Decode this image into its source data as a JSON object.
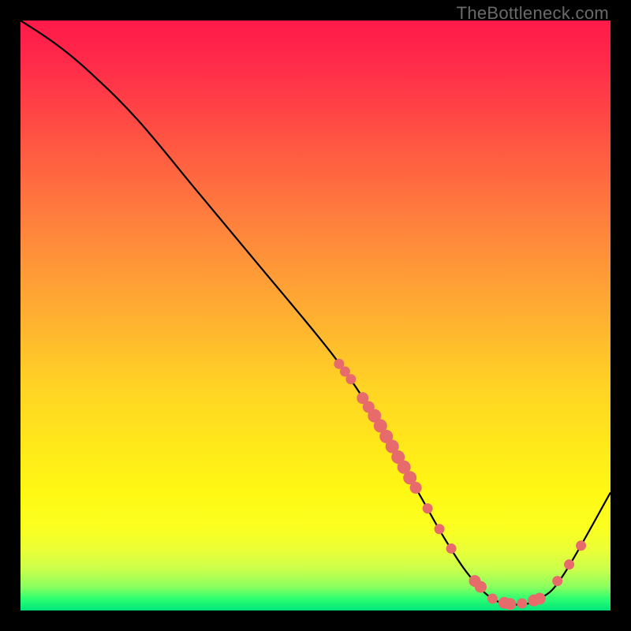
{
  "attribution": "TheBottleneck.com",
  "chart_data": {
    "type": "line",
    "title": "",
    "xlabel": "",
    "ylabel": "",
    "xlim": [
      0,
      100
    ],
    "ylim": [
      0,
      100
    ],
    "grid": false,
    "series": [
      {
        "name": "curve",
        "x": [
          0,
          6,
          12,
          20,
          30,
          40,
          50,
          55,
          60,
          64,
          68,
          72,
          76,
          80,
          84,
          88,
          92,
          100
        ],
        "values": [
          100,
          96,
          91,
          83,
          71,
          59,
          47,
          40.5,
          33,
          26,
          19,
          12,
          6,
          2,
          1,
          2,
          6,
          20
        ]
      }
    ],
    "markers": [
      {
        "x": 54.0,
        "y": 41.8,
        "r": 6
      },
      {
        "x": 55.0,
        "y": 40.5,
        "r": 6
      },
      {
        "x": 56.0,
        "y": 39.2,
        "r": 6
      },
      {
        "x": 58.0,
        "y": 36.0,
        "r": 7
      },
      {
        "x": 59.0,
        "y": 34.5,
        "r": 7
      },
      {
        "x": 60.0,
        "y": 33.0,
        "r": 8
      },
      {
        "x": 61.0,
        "y": 31.3,
        "r": 8
      },
      {
        "x": 62.0,
        "y": 29.5,
        "r": 8
      },
      {
        "x": 63.0,
        "y": 27.8,
        "r": 8
      },
      {
        "x": 64.0,
        "y": 26.0,
        "r": 8
      },
      {
        "x": 65.0,
        "y": 24.3,
        "r": 8
      },
      {
        "x": 66.0,
        "y": 22.5,
        "r": 8
      },
      {
        "x": 67.0,
        "y": 20.8,
        "r": 7
      },
      {
        "x": 69.0,
        "y": 17.3,
        "r": 6
      },
      {
        "x": 71.0,
        "y": 13.8,
        "r": 6
      },
      {
        "x": 73.0,
        "y": 10.5,
        "r": 6
      },
      {
        "x": 77.0,
        "y": 5.0,
        "r": 7
      },
      {
        "x": 78.0,
        "y": 4.0,
        "r": 7
      },
      {
        "x": 80.0,
        "y": 2.0,
        "r": 6
      },
      {
        "x": 82.0,
        "y": 1.3,
        "r": 7
      },
      {
        "x": 83.0,
        "y": 1.1,
        "r": 7
      },
      {
        "x": 85.0,
        "y": 1.2,
        "r": 6
      },
      {
        "x": 87.0,
        "y": 1.7,
        "r": 7
      },
      {
        "x": 88.0,
        "y": 2.0,
        "r": 7
      },
      {
        "x": 91.0,
        "y": 5.0,
        "r": 6
      },
      {
        "x": 93.0,
        "y": 7.8,
        "r": 6
      },
      {
        "x": 95.0,
        "y": 11.0,
        "r": 6
      }
    ],
    "colors": {
      "curve": "#000000",
      "marker_fill": "#e76b6b",
      "marker_stroke": "#e76b6b"
    }
  }
}
